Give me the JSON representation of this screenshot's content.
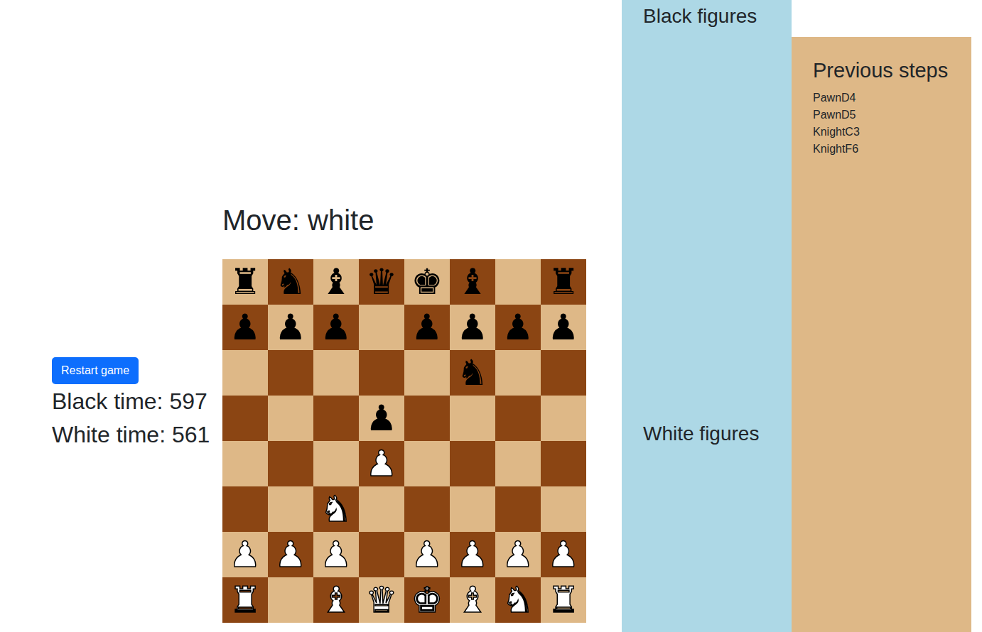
{
  "turn": "Move: white",
  "restart_button": "Restart game",
  "timers": [
    "Black time: 597",
    "White time: 561"
  ],
  "board": [
    [
      {
        "piece": "♜",
        "side": "black"
      },
      {
        "piece": "♞",
        "side": "black"
      },
      {
        "piece": "♝",
        "side": "black"
      },
      {
        "piece": "♛",
        "side": "black"
      },
      {
        "piece": "♚",
        "side": "black"
      },
      {
        "piece": "♝",
        "side": "black"
      },
      null,
      {
        "piece": "♜",
        "side": "black"
      }
    ],
    [
      {
        "piece": "♟",
        "side": "black"
      },
      {
        "piece": "♟",
        "side": "black"
      },
      {
        "piece": "♟",
        "side": "black"
      },
      null,
      {
        "piece": "♟",
        "side": "black"
      },
      {
        "piece": "♟",
        "side": "black"
      },
      {
        "piece": "♟",
        "side": "black"
      },
      {
        "piece": "♟",
        "side": "black"
      }
    ],
    [
      null,
      null,
      null,
      null,
      null,
      {
        "piece": "♞",
        "side": "black"
      },
      null,
      null
    ],
    [
      null,
      null,
      null,
      {
        "piece": "♟",
        "side": "black"
      },
      null,
      null,
      null,
      null
    ],
    [
      null,
      null,
      null,
      {
        "piece": "♟",
        "side": "white"
      },
      null,
      null,
      null,
      null
    ],
    [
      null,
      null,
      {
        "piece": "♞",
        "side": "white"
      },
      null,
      null,
      null,
      null,
      null
    ],
    [
      {
        "piece": "♟",
        "side": "white"
      },
      {
        "piece": "♟",
        "side": "white"
      },
      {
        "piece": "♟",
        "side": "white"
      },
      null,
      {
        "piece": "♟",
        "side": "white"
      },
      {
        "piece": "♟",
        "side": "white"
      },
      {
        "piece": "♟",
        "side": "white"
      },
      {
        "piece": "♟",
        "side": "white"
      }
    ],
    [
      {
        "piece": "♜",
        "side": "white"
      },
      null,
      {
        "piece": "♝",
        "side": "white"
      },
      {
        "piece": "♛",
        "side": "white"
      },
      {
        "piece": "♚",
        "side": "white"
      },
      {
        "piece": "♝",
        "side": "white"
      },
      {
        "piece": "♞",
        "side": "white"
      },
      {
        "piece": "♜",
        "side": "white"
      }
    ]
  ],
  "captured": {
    "black_title": "Black figures",
    "black": [],
    "white_title": "White figures",
    "white": []
  },
  "history": {
    "title": "Previous steps",
    "steps": [
      "PawnD4",
      "PawnD5",
      "KnightC3",
      "KnightF6"
    ]
  }
}
